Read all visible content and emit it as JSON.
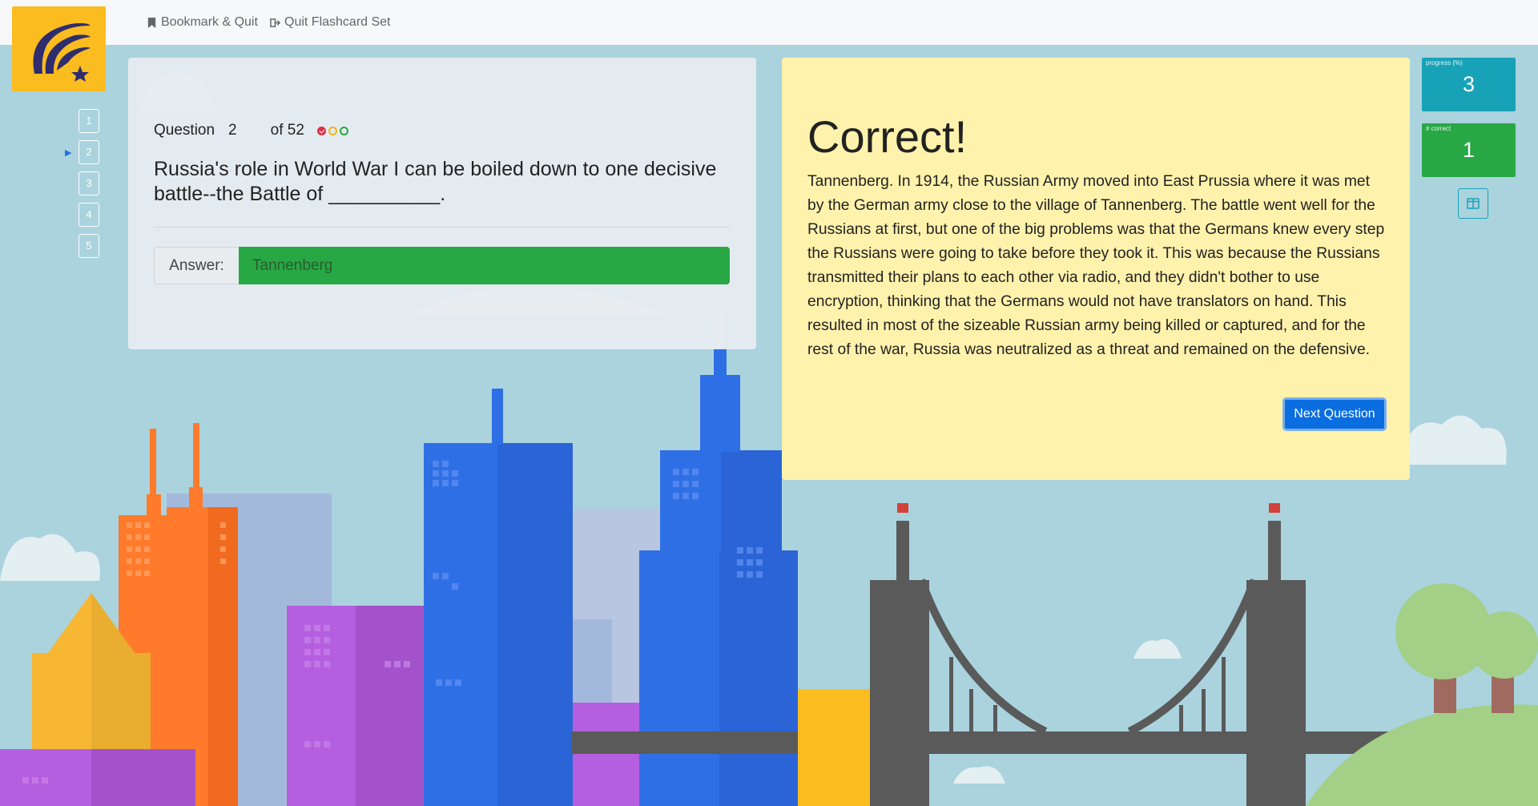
{
  "topbar": {
    "bookmark_label": "Bookmark & Quit",
    "quit_label": "Quit Flashcard Set"
  },
  "question_nav": {
    "items": [
      "1",
      "2",
      "3",
      "4",
      "5"
    ],
    "current": "2"
  },
  "question": {
    "label": "Question",
    "number": "2",
    "of_label": "of 52",
    "text": "Russia's role in World War I can be boiled down to one decisive battle--the Battle of __________.",
    "answer_label": "Answer:",
    "answer_value": "Tannenberg",
    "status_dots": [
      "correct",
      "pending",
      "pending"
    ]
  },
  "feedback": {
    "title": "Correct!",
    "explanation": "Tannenberg. In 1914, the Russian Army moved into East Prussia where it was met by the German army close to the village of Tannenberg. The battle went well for the Russians at first, but one of the big problems was that the Germans knew every step the Russians were going to take before they took it. This was because the Russians transmitted their plans to each other via radio, and they didn't bother to use encryption, thinking that the Germans would not have translators on hand. This resulted in most of the sizeable Russian army being killed or captured, and for the rest of the war, Russia was neutralized as a threat and remained on the defensive.",
    "next_label": "Next Question"
  },
  "stats": {
    "progress_label": "progress (%)",
    "progress_value": "3",
    "correct_label": "# correct",
    "correct_value": "1"
  },
  "colors": {
    "sky": "#aad3de",
    "logo_bg": "#fbbc1f",
    "feedback_bg": "#fff2ac",
    "answer_bg": "#28a745",
    "progress_bg": "#17a2b8",
    "correct_bg": "#28a745",
    "primary_button": "#0a6de0"
  }
}
